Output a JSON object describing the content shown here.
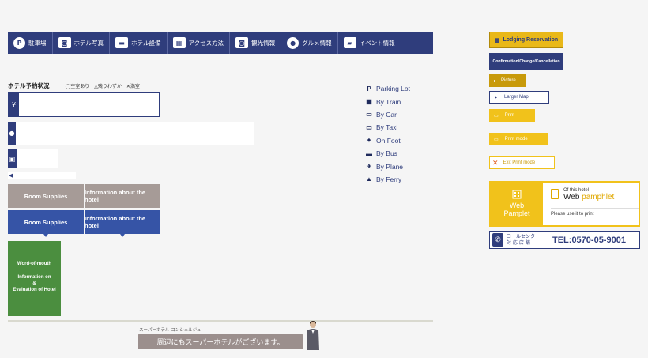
{
  "nav": {
    "items": [
      {
        "label": "駐車場",
        "icon": "parking-icon",
        "glyph": "P"
      },
      {
        "label": "ホテル写真",
        "icon": "camera-icon",
        "glyph": "◙"
      },
      {
        "label": "ホテル設備",
        "icon": "bed-icon",
        "glyph": "▬"
      },
      {
        "label": "アクセス方法",
        "icon": "map-icon",
        "glyph": "▦"
      },
      {
        "label": "観光情報",
        "icon": "camera-icon",
        "glyph": "◙"
      },
      {
        "label": "グルメ情報",
        "icon": "dining-icon",
        "glyph": "●"
      },
      {
        "label": "イベント情報",
        "icon": "speech-bubble-icon",
        "glyph": "▰"
      }
    ]
  },
  "availability": {
    "title": "ホテル予約状況",
    "legend": [
      "◯空室あり",
      "△残りわずか",
      "✕満室"
    ]
  },
  "boxes": {
    "yen_glyph": "¥",
    "chat_glyph": "●",
    "bus_glyph": "▣",
    "megaphone_glyph": "◀"
  },
  "tabs_grey": [
    "Room Supplies",
    "Information about the hotel"
  ],
  "tabs_blue": [
    "Room Supplies",
    "Information about the hotel"
  ],
  "word_of_mouth": {
    "line1": "Word-of-mouth",
    "line2": "Information on",
    "line3": "&",
    "line4": "Evaluation of Hotel"
  },
  "footer": {
    "concierge": "スーパーホテル コンシェルジュ",
    "nearby": "周辺にもスーパーホテルがございます。"
  },
  "access": [
    {
      "label": "Parking Lot",
      "glyph": "P",
      "icon": "parking-icon"
    },
    {
      "label": "By Train",
      "glyph": "▣",
      "icon": "train-icon"
    },
    {
      "label": "By Car",
      "glyph": "▭",
      "icon": "car-icon"
    },
    {
      "label": "By Taxi",
      "glyph": "▭",
      "icon": "taxi-icon"
    },
    {
      "label": "On Foot",
      "glyph": "✦",
      "icon": "walking-icon"
    },
    {
      "label": "By Bus",
      "glyph": "▬",
      "icon": "bus-icon"
    },
    {
      "label": "By Plane",
      "glyph": "✈",
      "icon": "plane-icon"
    },
    {
      "label": "By Ferry",
      "glyph": "▲",
      "icon": "ferry-icon"
    }
  ],
  "right": {
    "lodging": "Lodging Reservation",
    "lodging_glyph": "▦",
    "confirm": "Confirmation/Change/Cancellation",
    "picture": "Picture",
    "large_map": "Larger Map",
    "print": "Print",
    "print_mode": "Print mode",
    "exit_print_mode": "Exit Print mode",
    "arrow_glyph": "▸",
    "printer_glyph": "▭",
    "exit_glyph": "✕"
  },
  "web_pamphlet": {
    "left_line1": "Web",
    "left_line2": "Pamplet",
    "of_this": "Of this hotel",
    "title_word": "Web",
    "title_accent": "pamphlet",
    "use": "Please use it to print"
  },
  "call_center": {
    "phone_glyph": "✆",
    "line1": "コールセンター",
    "line2": "対 応 店 舗",
    "tel": "TEL:0570-05-9001"
  },
  "colors": {
    "navy": "#2f3d7c",
    "gold": "#f1c21b",
    "green": "#4b8e3f",
    "taupe": "#a69b97"
  }
}
